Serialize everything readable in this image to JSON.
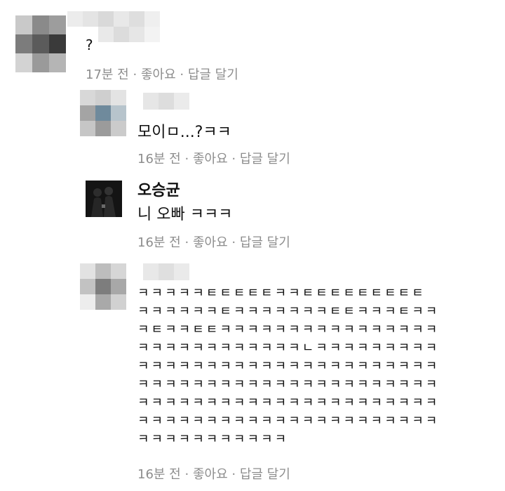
{
  "comments": [
    {
      "text": "?",
      "meta": {
        "time": "17분 전",
        "like": "좋아요",
        "reply": "답글 달기"
      }
    },
    {
      "text": "모이ㅁ...?ㅋㅋ",
      "meta": {
        "time": "16분 전",
        "like": "좋아요",
        "reply": "답글 달기"
      }
    },
    {
      "author": "오승균",
      "text": "니 오빠 ㅋㅋㅋ",
      "meta": {
        "time": "16분 전",
        "like": "좋아요",
        "reply": "답글 달기"
      }
    },
    {
      "lines": [
        "ㅋㅋㅋㅋㅋㅌㅌㅌㅌㅌㅋㅋㅌㅌㅌㅌㅌㅌㅌㅌㅌ",
        "ㅋㅋㅋㅋㅋㅋㅌㅋㅋㅋㅋㅋㅋㅋㅌㅌㅋㅋㅋㅌㅋㅋ",
        "ㅋㅌㅋㅋㅌㅌㅋㅋㅋㅋㅋㅋㅋㅋㅋㅋㅋㅋㅋㅋㅋㅋ",
        "ㅋㅋㅋㅋㅋㅋㅋㅋㅋㅋㅋㅋㄴㅋㅋㅋㅋㅋㅋㅋㅋㅋ",
        "ㅋㅋㅋㅋㅋㅋㅋㅋㅋㅋㅋㅋㅋㅋㅋㅋㅋㅋㅋㅋㅋㅋ",
        "ㅋㅋㅋㅋㅋㅋㅋㅋㅋㅋㅋㅋㅋㅋㅋㅋㅋㅋㅋㅋㅋㅋ",
        "ㅋㅋㅋㅋㅋㅋㅋㅋㅋㅋㅋㅋㅋㅋㅋㅋㅋㅋㅋㅋㅋㅋ",
        "ㅋㅋㅋㅋㅋㅋㅋㅋㅋㅋㅋㅋㅋㅋㅋㅋㅋㅋㅋㅋㅋㅋ",
        "ㅋㅋㅋㅋㅋㅋㅋㅋㅋㅋㅋ"
      ],
      "meta": {
        "time": "16분 전",
        "like": "좋아요",
        "reply": "답글 달기"
      }
    }
  ],
  "meta_separator": "·",
  "colors": {
    "meta": "#8d8d8d",
    "text": "#111111"
  }
}
